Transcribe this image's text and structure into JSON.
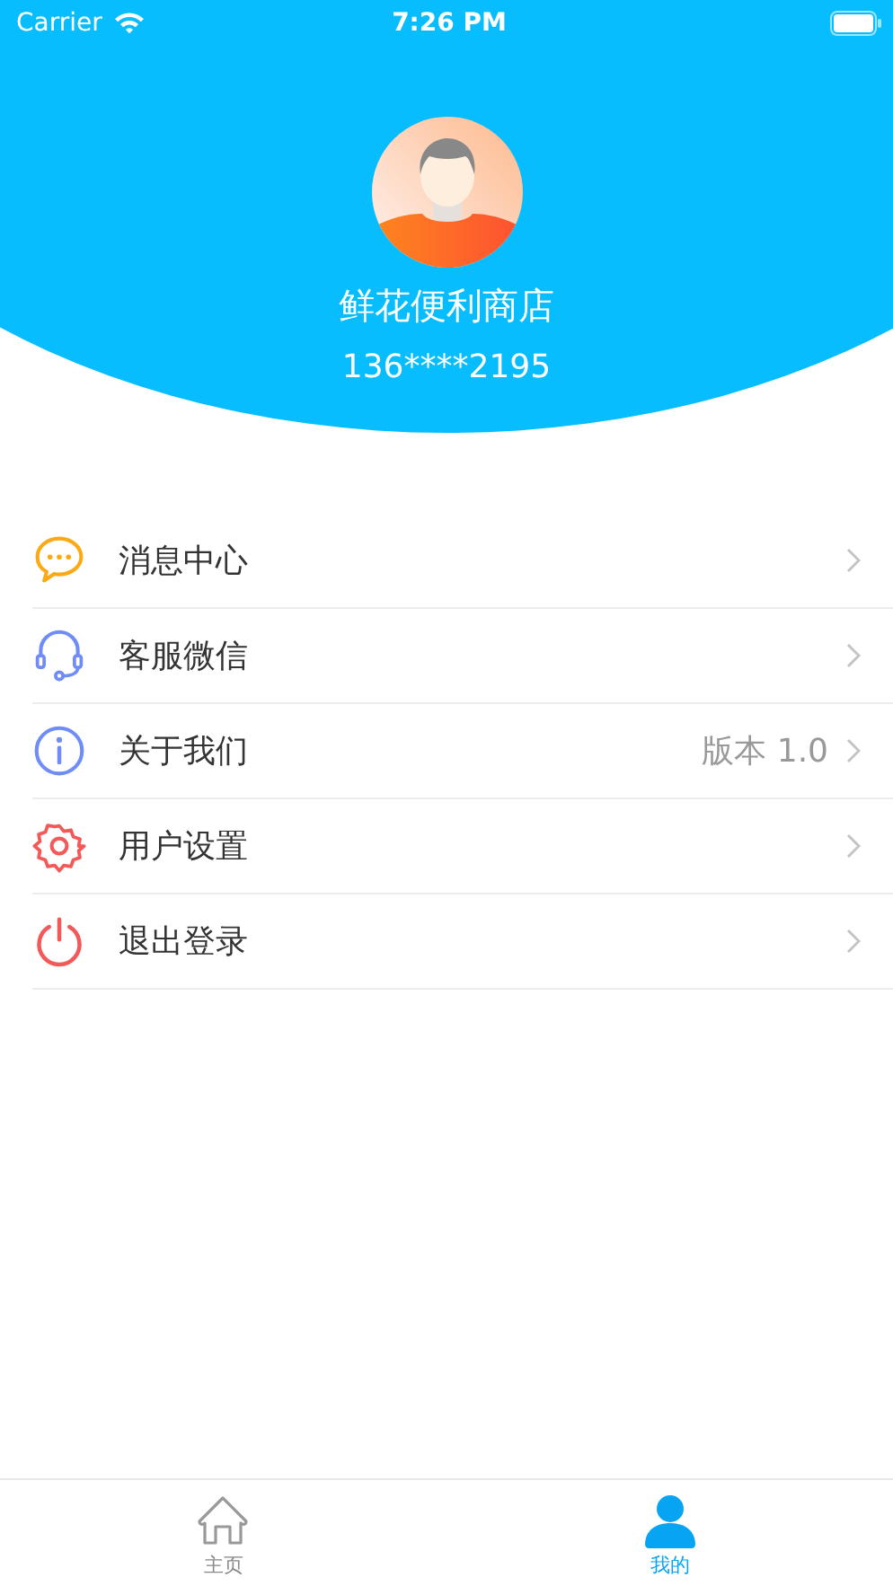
{
  "status_bar": {
    "carrier": "Carrier",
    "time": "7:26 PM"
  },
  "profile": {
    "name": "鲜花便利商店",
    "phone": "136****2195"
  },
  "menu": [
    {
      "label": "消息中心"
    },
    {
      "label": "客服微信"
    },
    {
      "label": "关于我们",
      "value": "版本 1.0"
    },
    {
      "label": "用户设置"
    },
    {
      "label": "退出登录"
    }
  ],
  "tab_bar": [
    {
      "label": "主页",
      "selected": false
    },
    {
      "label": "我的",
      "selected": true
    }
  ]
}
